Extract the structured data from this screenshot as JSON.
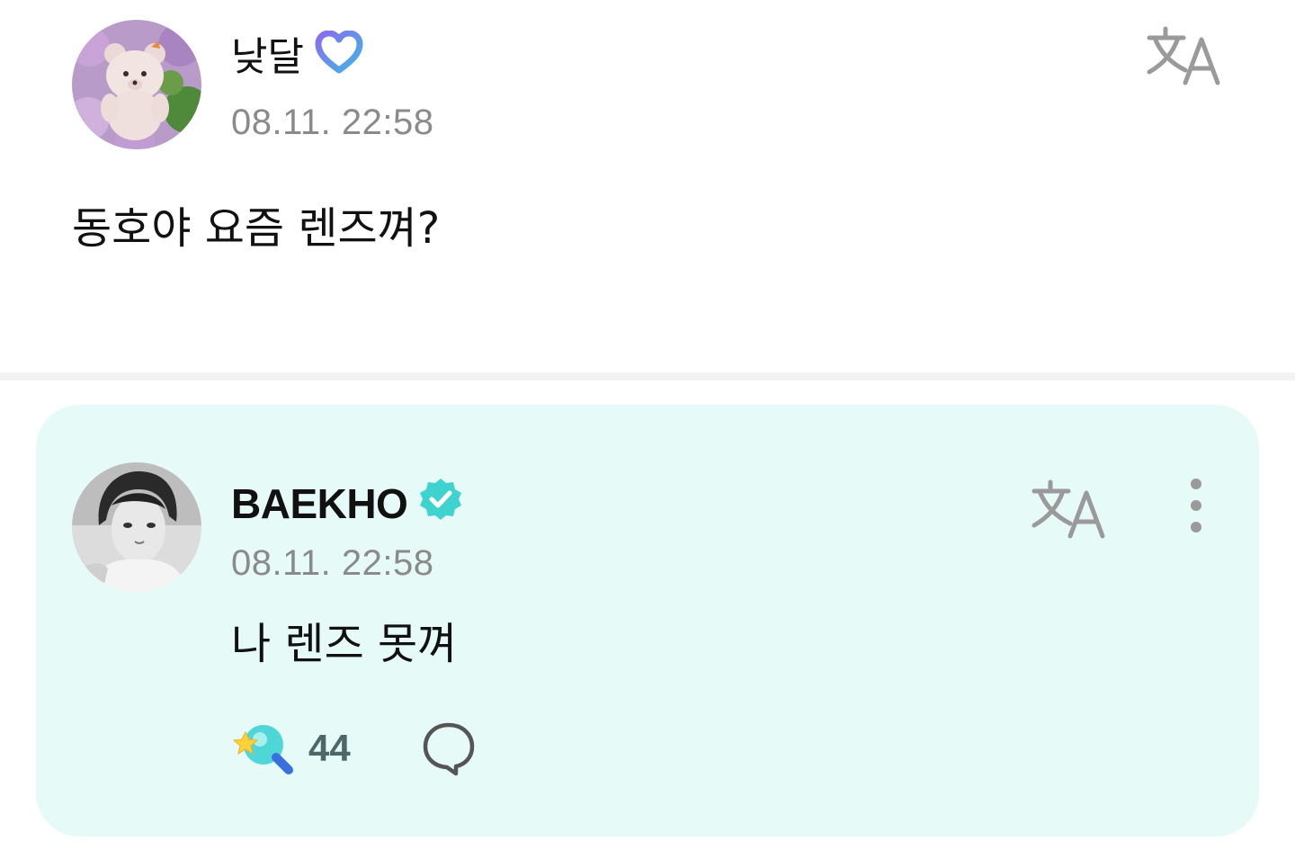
{
  "post": {
    "author": "낮달",
    "timestamp": "08.11. 22:58",
    "body": "동호야 요즘 렌즈껴?",
    "author_badge_icon": "heart-badge-icon",
    "translate_icon": "translate-icon"
  },
  "reply": {
    "author": "BAEKHO",
    "timestamp": "08.11. 22:58",
    "body": "나 렌즈 못껴",
    "verified_icon": "verified-badge-icon",
    "translate_icon": "translate-icon",
    "more_icon": "more-vertical-icon",
    "reaction_icon": "lightstick-icon",
    "reaction_count": "44",
    "comment_icon": "comment-icon"
  },
  "colors": {
    "reply_background": "#e6fbf7",
    "verified_badge": "#3fd3cf",
    "timestamp": "#8a8a8a",
    "divider": "#f2f3f3"
  }
}
